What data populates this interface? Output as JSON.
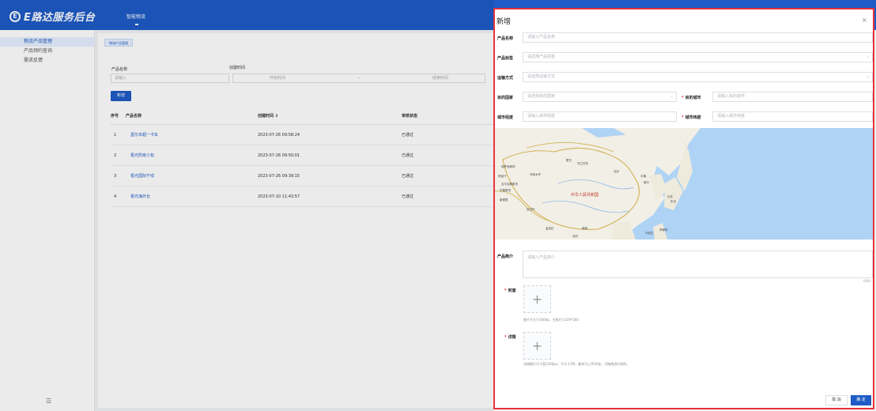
{
  "header": {
    "logo_mark": "E",
    "logo_text": "E路达服务后台",
    "nav_item": "智能物流"
  },
  "sidebar": {
    "items": [
      {
        "label": "物流产品管理"
      },
      {
        "label": "产品预约查询"
      },
      {
        "label": "需求反馈"
      }
    ],
    "collapse_glyph": "☰"
  },
  "main": {
    "tab_label": "物流产品管理",
    "search": {
      "name_label": "产品名称",
      "name_placeholder": "请输入",
      "time_label": "创建时间",
      "start_placeholder": "开始时间",
      "sep": "-",
      "end_placeholder": "结束时间"
    },
    "add_button": "新增",
    "table": {
      "headers": [
        "序号",
        "产品名称",
        "创建时间 ⇕",
        "审核状态"
      ],
      "rows": [
        {
          "no": "1",
          "name": "墨尔本超一卡车",
          "time": "2023-07-26 09:58:24",
          "status": "已通过"
        },
        {
          "no": "2",
          "name": "极光防疫小包",
          "time": "2023-07-26 09:50:01",
          "status": "已通过"
        },
        {
          "no": "3",
          "name": "极光国际干线",
          "time": "2023-07-26 09:39:15",
          "status": "已通过"
        },
        {
          "no": "4",
          "name": "极光海外仓",
          "time": "2023-07-10 11:43:57",
          "status": "已通过"
        }
      ]
    }
  },
  "dialog": {
    "title": "新增",
    "close": "×",
    "fields": {
      "product_name_label": "产品名称",
      "product_name_placeholder": "请输入产品名称",
      "product_tag_label": "产品标签",
      "product_tag_placeholder": "请选择产品标签",
      "transport_label": "运输方式",
      "transport_placeholder": "请选择运输方式",
      "dest_country_label": "目的国家",
      "dest_country_placeholder": "请选择目的国家",
      "dest_city_label": "目的城市",
      "dest_city_placeholder": "请输入目的城市",
      "city_lng_label": "城市经度",
      "city_lng_placeholder": "请输入城市经度",
      "city_lat_label": "城市纬度",
      "city_lat_placeholder": "请输入城市纬度",
      "intro_label": "产品简介",
      "intro_placeholder": "请输入产品简介",
      "intro_counter": "0/60",
      "cover_label": "封面",
      "cover_hint": "图片不大于200kb，主图尺寸229*160",
      "detail_label": "详情",
      "detail_hint": "详情图片尺寸宽1200px，不大于1M，最多可上传10张，可拖拽进行排序。"
    },
    "map": {
      "country_label": "中华人民共和国",
      "labels": [
        "蒙古",
        "乌兰巴托",
        "哈萨克斯坦",
        "吉尔吉斯斯坦",
        "日本",
        "东京",
        "北京",
        "首尔",
        "平壤",
        "马尼拉",
        "越南",
        "新德里",
        "河内",
        "菲律宾",
        "阿富汗",
        "巴基斯坦",
        "乌鲁木齐",
        "尼泊尔",
        "孟加拉"
      ]
    },
    "cancel_button": "取 消",
    "ok_button": "确 定",
    "upload_glyph": "+",
    "chevron": "⌄"
  },
  "colors": {
    "brand": "#1e5bc6",
    "highlight_border": "#e8323c",
    "required": "#e8323c"
  }
}
